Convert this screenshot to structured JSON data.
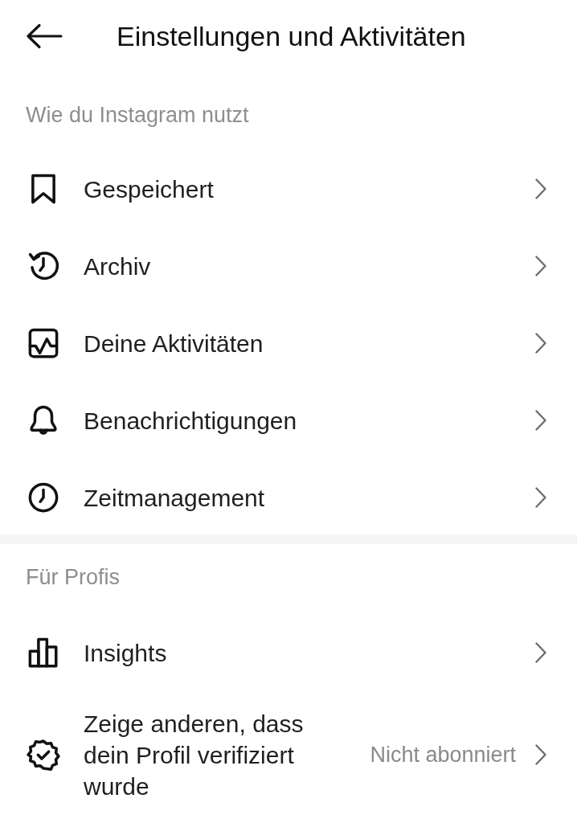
{
  "header": {
    "title": "Einstellungen und Aktivitäten"
  },
  "sections": [
    {
      "title": "Wie du Instagram nutzt",
      "items": [
        {
          "label": "Gespeichert"
        },
        {
          "label": "Archiv"
        },
        {
          "label": "Deine Aktivitäten"
        },
        {
          "label": "Benachrichtigungen"
        },
        {
          "label": "Zeitmanagement"
        }
      ]
    },
    {
      "title": "Für Profis",
      "items": [
        {
          "label": "Insights"
        },
        {
          "label": "Zeige anderen, dass dein Profil verifiziert wurde",
          "value": "Nicht abonniert"
        }
      ]
    }
  ]
}
